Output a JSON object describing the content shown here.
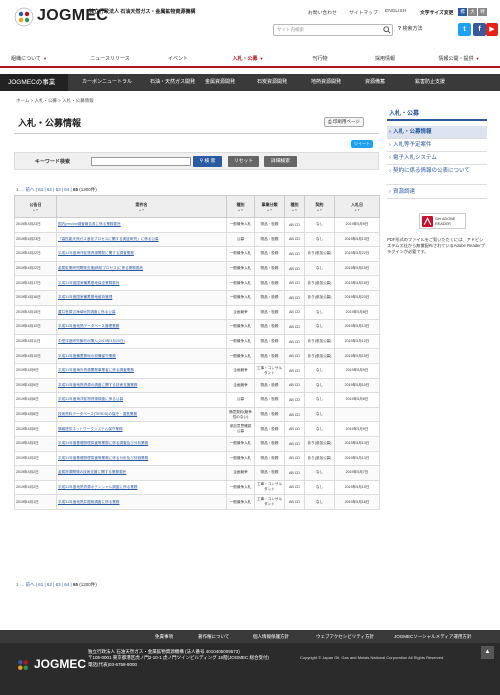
{
  "header": {
    "logo_text": "JOGMEC",
    "org_name": "独立行政法人 石油天然ガス・金属鉱物資源機構",
    "util_links": [
      "お問い合わせ",
      "サイトマップ",
      "ENGLISH"
    ],
    "font_size_label": "文字サイズ変更",
    "font_sizes": [
      "標",
      "大",
      "特"
    ],
    "search_placeholder": "サイト内検索",
    "search_button": "検索方法",
    "social": [
      "t",
      "f",
      "▶"
    ]
  },
  "gnav": {
    "items": [
      "組織について",
      "ニュースリリース",
      "イベント",
      "入札・公募",
      "刊行物",
      "採用情報",
      "情報公開・提供"
    ],
    "active_index": 3
  },
  "biz_nav": {
    "title": "JOGMECの事業",
    "items": [
      "カーボンニュートラル",
      "石油・天然ガス開発",
      "金属資源開発",
      "石炭資源開発",
      "地熱資源開発",
      "資源備蓄",
      "鉱害防止支援"
    ]
  },
  "breadcrumb": "ホーム > 入札・公募 > 入札・公募情報",
  "main": {
    "title": "入札・公募情報",
    "print_label": "印刷用ページ",
    "tweet_label": "ツイート",
    "keyword_label": "キーワード検索",
    "search_label": "検 索",
    "reset_label": "リセット",
    "detail_label": "詳細検索"
  },
  "pager": {
    "first": "1",
    "prev": "前へ",
    "pages": [
      "61",
      "62",
      "63",
      "64"
    ],
    "current": "65",
    "count": "(1300件)"
  },
  "table": {
    "headers": [
      "公告日",
      "案件名",
      "種別",
      "事業分類",
      "種別",
      "契約",
      "入札日"
    ],
    "rows": [
      [
        "2019年4月23日",
        "国内preview調査報告書に係る業務委託",
        "一般競争入札",
        "物品・役務",
        "AB CD",
        "なし",
        "2019年5月9日"
      ],
      [
        "2019年4月23日",
        "「高性能天然ガス液化プロセスに関する実証研究」に係る公募",
        "公募",
        "物品・役務",
        "AB CD",
        "なし",
        "2019年5月13日"
      ],
      [
        "2019年4月22日",
        "平成31年度海洋鉱物資源開発に関する調査業務",
        "一般競争入札",
        "物品・役務",
        "AB CD",
        "あり(参加公募)",
        "2019年5月22日"
      ],
      [
        "2019年4月22日",
        "金属鉱業研究開発支援(精鉱プロセス)に係る業務委託",
        "一般競争入札",
        "物品・役務",
        "AB CD",
        "なし",
        "2019年5月15日"
      ],
      [
        "2019年4月17日",
        "平成31年度国家備蓄基地保全業務委託",
        "一般競争入札",
        "物品・役務",
        "AB CD",
        "あり(参加公募)",
        "2019年5月16日"
      ],
      [
        "2019年4月16日",
        "平成31年度国家備蓄基地維持管理",
        "一般競争入札",
        "物品・役務",
        "AB CD",
        "あり(参加公募)",
        "2019年5月23日"
      ],
      [
        "2019年4月15日",
        "蓋井島周辺海域地質調査に係る公募",
        "企画競争",
        "物品・役務",
        "AB CD",
        "なし",
        "2019年5月8日"
      ],
      [
        "2019年4月12日",
        "平成31年度地熱データベース管理業務",
        "一般競争入札",
        "物品・役務",
        "AB CD",
        "なし",
        "2019年5月13日"
      ],
      [
        "2019年4月11日",
        "中型浮遊研究機材の購入(2019年4月25日)",
        "一般競争入札",
        "物品・役務",
        "AB CD",
        "あり(参加公募)",
        "2019年5月10日"
      ],
      [
        "2019年4月10日",
        "平成31年度備蓄基地の設備保守業務",
        "一般競争入札",
        "物品・役務",
        "AB CD",
        "あり(参加公募)",
        "2019年5月15日"
      ],
      [
        "2019年4月9日",
        "平成31年度海外資源開発事業者に係る調査業務",
        "企画競争",
        "工事・コンサルタント",
        "AB CD",
        "なし",
        "2019年5月9日"
      ],
      [
        "2019年4月9日",
        "平成31年度地熱資源の調査に関する技術支援業務",
        "企画競争",
        "物品・役務",
        "AB CD",
        "なし",
        "2019年5月10日"
      ],
      [
        "2019年4月8日",
        "平成31年度海洋鉱物資源調査に係る公募",
        "公募",
        "物品・役務",
        "AB CD",
        "なし",
        "2019年5月8日"
      ],
      [
        "2019年4月8日",
        "技術資料データベース(TERDS)の保守・運営業務",
        "随意契約(競争性のない)",
        "物品・役務",
        "AB CD",
        "なし",
        ""
      ],
      [
        "2019年4月5日",
        "情報提供ネットワークシステム保守業務",
        "参加意思確認公募",
        "物品・役務",
        "AB CD",
        "なし",
        "2019年5月9日"
      ],
      [
        "2019年4月3日",
        "平成31年度基礎物理探査等業務に係る調査及び分析業務",
        "一般競争入札",
        "物品・役務",
        "AB CD",
        "あり(参加公募)",
        "2019年5月13日"
      ],
      [
        "2019年4月3日",
        "平成31年度基礎物理探査等業務に係る分析及び評価業務",
        "一般競争入札",
        "物品・役務",
        "AB CD",
        "あり(参加公募)",
        "2019年5月13日"
      ],
      [
        "2019年4月2日",
        "金属資源開発の技術支援に関する業務委託",
        "企画競争",
        "物品・役務",
        "AB CD",
        "なし",
        "2019年5月7日"
      ],
      [
        "2019年4月2日",
        "平成31年度地熱資源ポテンシャル調査に係る業務",
        "一般競争入札",
        "工事・コンサルタント",
        "AB CD",
        "なし",
        "2019年5月15日"
      ],
      [
        "2019年4月1日",
        "平成31年度地熱井掘削調査に係る業務",
        "一般競争入札",
        "工事・コンサルタント",
        "AB CD",
        "なし",
        "2019年5月16日"
      ]
    ]
  },
  "side": {
    "head": "入札・公募",
    "items": [
      "入札・公募情報",
      "入札等予定案件",
      "電子入札システム",
      "契約に係る情報の公表について",
      "資源調達"
    ],
    "active_index": 0,
    "adobe_label": "Get ADOBE READER",
    "adobe_note": "PDF形式のファイルをご覧いただくには、アドビシステムズ社から無償配布されているAdobe Readerプラグインが必要です。"
  },
  "footer": {
    "links": [
      "免責事項",
      "著作権について",
      "個人情報保護方針",
      "ウェブアクセシビリティ方針",
      "JOGMECソーシャルメディア運用方針"
    ],
    "logo_text": "JOGMEC",
    "org_lines": [
      "独立行政法人 石油天然ガス・金属鉱物資源機構 (法人番号 4010405009573)",
      "〒105-0001 東京都港区虎ノ門2-10-1 虎ノ門ツインビルディング 16階(JOGMEC 総合受付)",
      "電話(代表)03-6758-8000"
    ],
    "copyright": "Copyright © Japan Oil, Gas and Metals National Corporation All Rights Reserved.",
    "top_label": "▲"
  },
  "colors": {
    "accent_red": "#b3141e",
    "link_blue": "#2c5aa0",
    "dark_bar": "#3a3a3a"
  }
}
